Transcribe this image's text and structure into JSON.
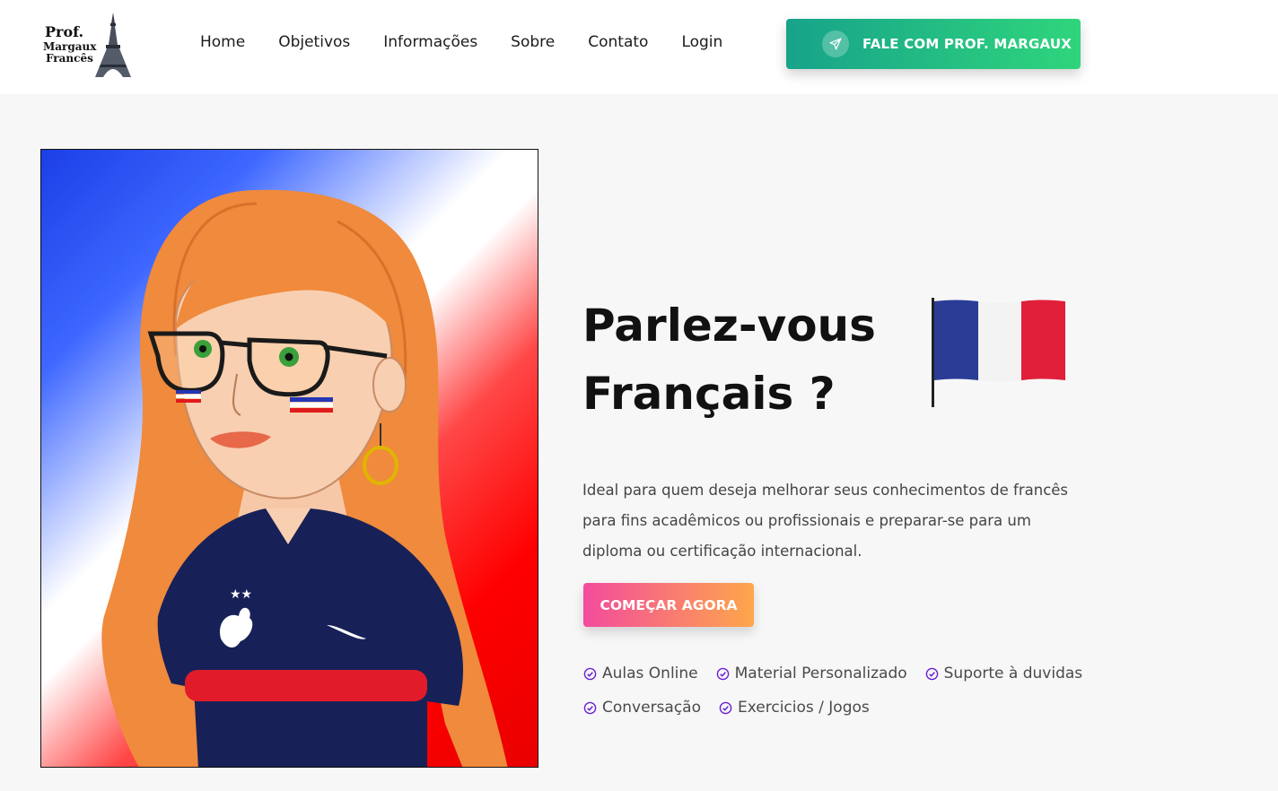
{
  "logo": {
    "line1": "Prof.",
    "line2": "Margaux",
    "line3": "Francês",
    "icon": "eiffel-tower-icon"
  },
  "nav": {
    "items": [
      "Home",
      "Objetivos",
      "Informações",
      "Sobre",
      "Contato",
      "Login"
    ]
  },
  "header_cta": {
    "label": "FALE COM PROF. MARGAUX",
    "icon": "paper-plane-icon",
    "gradient": [
      "#17a38a",
      "#2fd57c"
    ]
  },
  "hero": {
    "title_line1": "Parlez-vous",
    "title_line2": "Français ?",
    "flag_icon": "french-flag-icon",
    "description": "Ideal para quem deseja melhorar seus conhecimentos de francês para fins acadêmicos ou profissionais e preparar-se para um diploma ou certificação internacional.",
    "button_label": "COMEÇAR AGORA",
    "button_gradient": [
      "#f34b9d",
      "#fda74a"
    ],
    "features_row1": [
      "Aulas Online",
      "Material Personalizado",
      "Suporte à duvidas"
    ],
    "features_row2": [
      "Conversação",
      "Exercicios / Jogos"
    ],
    "feature_icon": "check-circle-icon",
    "accent_color": "#6a1fd1"
  },
  "portrait": {
    "icon": "teacher-cartoon-illustration"
  }
}
